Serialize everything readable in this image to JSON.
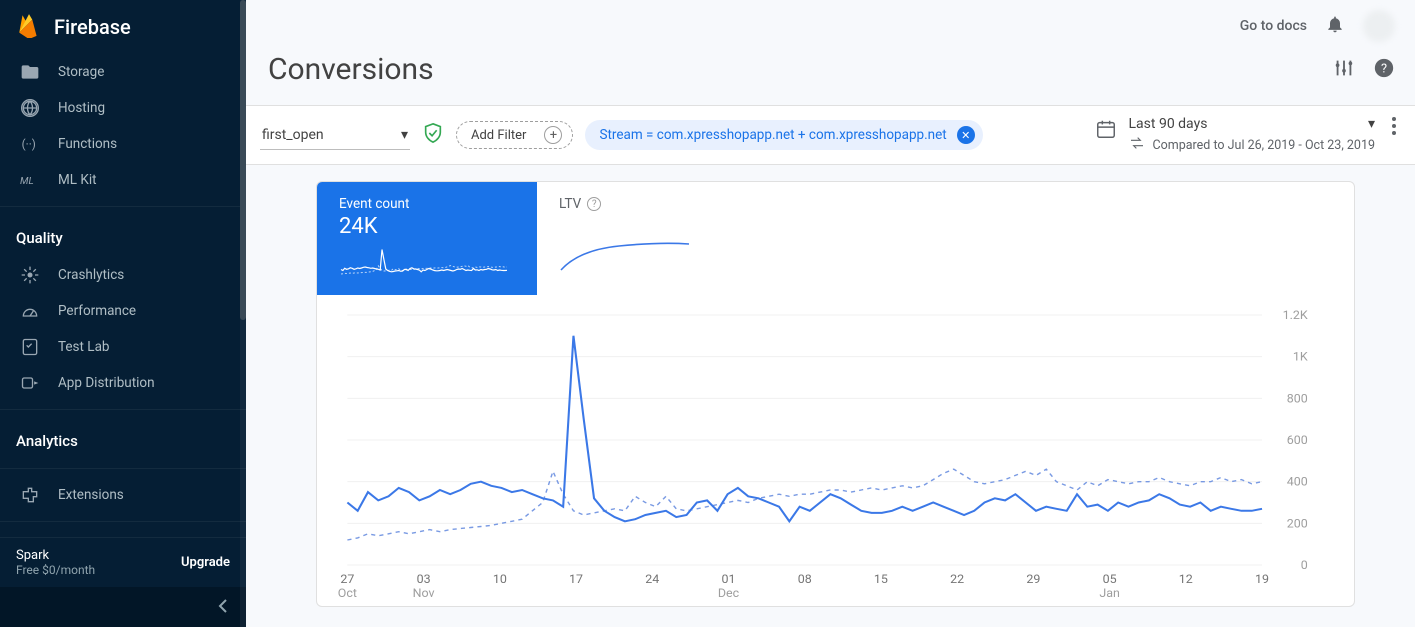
{
  "brand": "Firebase",
  "topbar": {
    "docs": "Go to docs"
  },
  "page": {
    "title": "Conversions"
  },
  "sidebar": {
    "items_top": [
      {
        "label": "Storage"
      },
      {
        "label": "Hosting"
      },
      {
        "label": "Functions"
      },
      {
        "label": "ML Kit"
      }
    ],
    "section_quality": "Quality",
    "items_quality": [
      {
        "label": "Crashlytics"
      },
      {
        "label": "Performance"
      },
      {
        "label": "Test Lab"
      },
      {
        "label": "App Distribution"
      }
    ],
    "section_analytics": "Analytics",
    "items_ext": [
      {
        "label": "Extensions"
      }
    ],
    "plan_name": "Spark",
    "plan_sub": "Free $0/month",
    "upgrade": "Upgrade"
  },
  "filters": {
    "event": "first_open",
    "add_filter": "Add Filter",
    "stream_chip": "Stream = com.xpresshopapp.net + com.xpresshopapp.net",
    "date_range": "Last 90 days",
    "compare": "Compared to Jul 26, 2019 - Oct 23, 2019"
  },
  "tabs": {
    "event_count": {
      "title": "Event count",
      "value": "24K"
    },
    "ltv": {
      "title": "LTV"
    }
  },
  "chart_data": {
    "type": "line",
    "ylim": [
      0,
      1200
    ],
    "yticks": [
      0,
      200,
      400,
      600,
      800,
      1000,
      1200
    ],
    "ytick_labels": [
      "0",
      "200",
      "400",
      "600",
      "800",
      "1K",
      "1.2K"
    ],
    "xtick_labels_top": [
      "27",
      "03",
      "10",
      "17",
      "24",
      "01",
      "08",
      "15",
      "22",
      "29",
      "05",
      "12",
      "19"
    ],
    "xtick_labels_bot": [
      "Oct",
      "Nov",
      "",
      "",
      "",
      "Dec",
      "",
      "",
      "",
      "",
      "Jan",
      "",
      ""
    ],
    "series": [
      {
        "name": "current",
        "values": [
          300,
          260,
          350,
          310,
          330,
          370,
          350,
          310,
          330,
          360,
          340,
          360,
          390,
          400,
          380,
          370,
          350,
          360,
          340,
          320,
          310,
          280,
          1100,
          700,
          320,
          260,
          230,
          210,
          220,
          240,
          250,
          260,
          230,
          240,
          300,
          310,
          260,
          340,
          370,
          330,
          320,
          300,
          280,
          210,
          280,
          260,
          300,
          340,
          320,
          290,
          260,
          250,
          250,
          260,
          280,
          260,
          280,
          300,
          280,
          260,
          240,
          260,
          300,
          320,
          310,
          340,
          300,
          260,
          280,
          270,
          260,
          340,
          280,
          290,
          260,
          300,
          280,
          300,
          310,
          340,
          320,
          290,
          280,
          300,
          260,
          280,
          270,
          260,
          260,
          270
        ]
      },
      {
        "name": "previous",
        "values": [
          120,
          130,
          150,
          140,
          150,
          160,
          150,
          160,
          170,
          160,
          170,
          175,
          180,
          185,
          190,
          200,
          210,
          220,
          260,
          300,
          450,
          340,
          260,
          240,
          250,
          260,
          270,
          260,
          330,
          300,
          280,
          330,
          270,
          260,
          270,
          280,
          290,
          300,
          310,
          300,
          320,
          330,
          340,
          330,
          340,
          340,
          350,
          360,
          360,
          350,
          360,
          370,
          360,
          370,
          380,
          370,
          380,
          410,
          440,
          460,
          430,
          400,
          390,
          400,
          410,
          430,
          450,
          430,
          460,
          400,
          380,
          360,
          400,
          380,
          410,
          400,
          390,
          400,
          400,
          420,
          400,
          390,
          380,
          400,
          400,
          420,
          400,
          410,
          390,
          400
        ]
      }
    ]
  }
}
